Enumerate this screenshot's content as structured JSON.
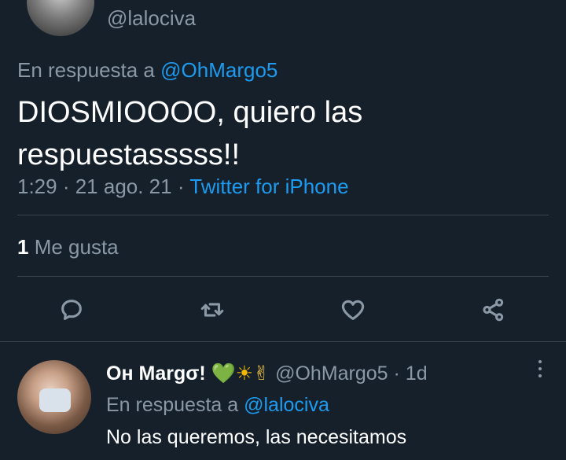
{
  "tweet": {
    "handle": "@lalociva",
    "reply_prefix": "En respuesta a ",
    "reply_mention": "@OhMargo5",
    "text": "DIOSMIOOOO, quiero las respuestasssss!!",
    "time": "1:29 · 21 ago. 21 · ",
    "source": "Twitter for iPhone",
    "likes_count": "1",
    "likes_label": " Me gusta",
    "icons": [
      "reply-icon",
      "retweet-icon",
      "like-icon",
      "share-icon"
    ]
  },
  "reply": {
    "name": "Oн Margσ!",
    "emoji_heart": "💚",
    "emoji_sun": "☀",
    "emoji_hand": "✌",
    "handle_time": "@OhMargo5 · 1d",
    "reply_prefix": "En respuesta a ",
    "reply_mention": "@lalociva",
    "text": "No las queremos, las necesitamos"
  },
  "colors": {
    "background": "#15202b",
    "link": "#1d9bf0",
    "muted": "#8b98a5",
    "divider": "#38444d"
  }
}
